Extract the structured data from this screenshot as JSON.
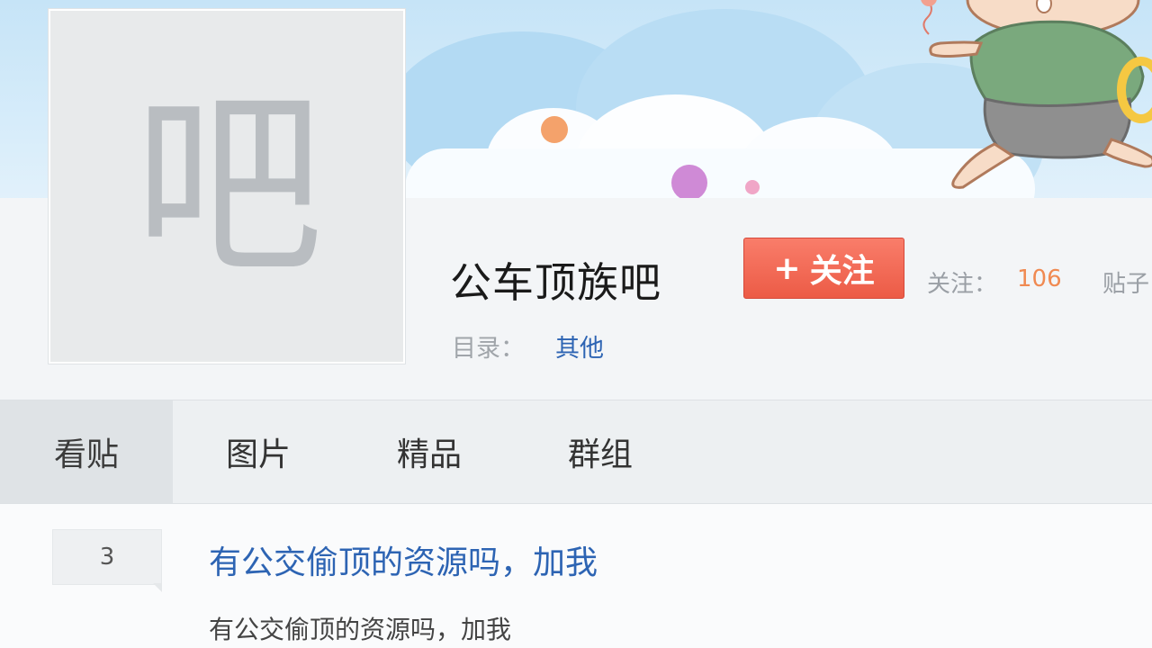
{
  "forum": {
    "avatar_glyph": "吧",
    "name": "公车顶族吧",
    "follow_button": "关注",
    "follow_plus": "+",
    "stats": {
      "follow_label": "关注：",
      "follow_count": "106",
      "posts_label": "贴子"
    },
    "catalog_label": "目录：",
    "catalog_value": "其他"
  },
  "tabs": [
    {
      "label": "看贴",
      "active": true
    },
    {
      "label": "图片",
      "active": false
    },
    {
      "label": "精品",
      "active": false
    },
    {
      "label": "群组",
      "active": false
    }
  ],
  "posts": [
    {
      "reply_count": "3",
      "title": "有公交偷顶的资源吗，加我",
      "snippet": "有公交偷顶的资源吗，加我"
    }
  ],
  "colors": {
    "follow_button": "#ec5b46",
    "link": "#2d64b3",
    "stat_value": "#f08a52"
  }
}
